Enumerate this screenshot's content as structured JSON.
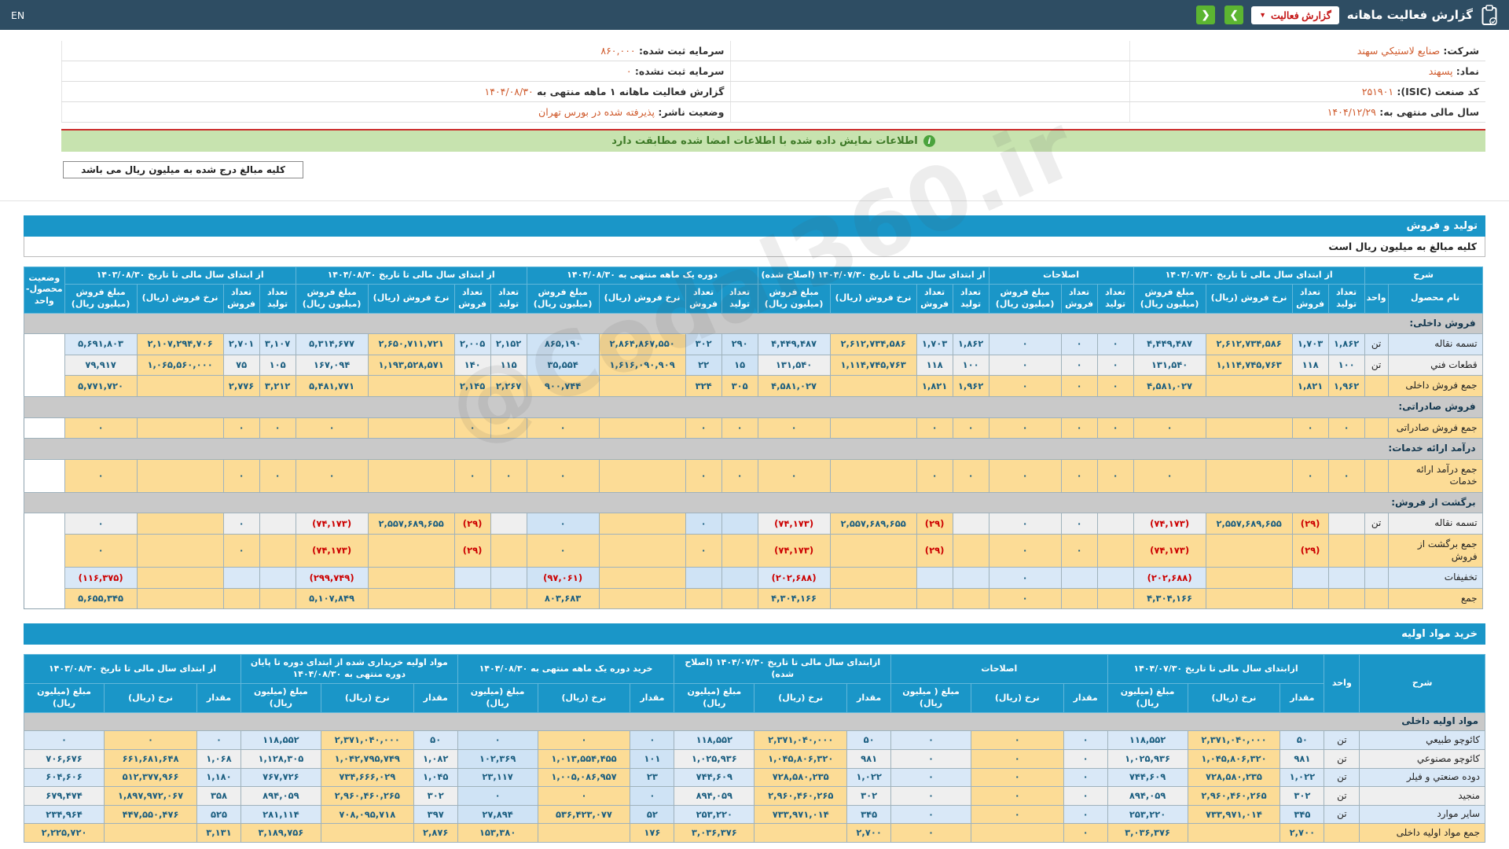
{
  "topbar": {
    "en": "EN",
    "title": "گزارش فعالیت ماهانه",
    "report_dropdown": "گزارش فعالیت"
  },
  "company_info": {
    "rows": [
      {
        "right_label": "شرکت:",
        "right_value": "صنايع لاستيکي سهند",
        "left_label": "سرمایه ثبت شده:",
        "left_value": "۸۶۰,۰۰۰"
      },
      {
        "right_label": "نماد:",
        "right_value": "پسهند",
        "left_label": "سرمایه ثبت نشده:",
        "left_value": "۰"
      },
      {
        "right_label": "کد صنعت (ISIC):",
        "right_value": "۲۵۱۹۰۱",
        "left_label": "گزارش فعالیت ماهانه ۱ ماهه منتهی به",
        "left_value": "۱۴۰۴/۰۸/۳۰"
      },
      {
        "right_label": "سال مالی منتهی به:",
        "right_value": "۱۴۰۴/۱۲/۲۹",
        "left_label": "وضعیت ناشر:",
        "left_value": "پذیرفته شده در بورس تهران"
      }
    ]
  },
  "notice": {
    "text": "اطلاعات نمایش داده شده با اطلاعات امضا شده مطابقت دارد"
  },
  "unit_note_box": "کلیه مبالغ درج شده به میلیون ریال می باشد",
  "watermark": "@Codal360.ir",
  "production_sales": {
    "section_title": "تولید و فروش",
    "unit_note": "کلیه مبالغ به میلیون ریال است",
    "groups": [
      {
        "title": "شرح",
        "subs": [
          "نام محصول",
          "واحد"
        ]
      },
      {
        "title": "از ابتدای سال مالی تا تاریخ ۱۴۰۴/۰۷/۳۰",
        "subs": [
          "تعداد تولید",
          "تعداد فروش",
          "نرخ فروش (ریال)",
          "مبلغ فروش (میلیون ریال)"
        ]
      },
      {
        "title": "اصلاحات",
        "subs": [
          "تعداد تولید",
          "تعداد فروش",
          "مبلغ فروش (میلیون ریال)"
        ]
      },
      {
        "title": "از ابتدای سال مالی تا تاریخ ۱۴۰۴/۰۷/۳۰ (اصلاح شده)",
        "subs": [
          "تعداد تولید",
          "تعداد فروش",
          "نرخ فروش (ریال)",
          "مبلغ فروش (میلیون ریال)"
        ]
      },
      {
        "title": "دوره یک ماهه منتهی به ۱۴۰۴/۰۸/۳۰",
        "hl": 1,
        "subs": [
          "تعداد تولید",
          "تعداد فروش",
          "نرخ فروش (ریال)",
          "مبلغ فروش (میلیون ریال)"
        ]
      },
      {
        "title": "از ابتدای سال مالی تا تاریخ ۱۴۰۴/۰۸/۳۰",
        "subs": [
          "تعداد تولید",
          "تعداد فروش",
          "نرخ فروش (ریال)",
          "مبلغ فروش (میلیون ریال)"
        ]
      },
      {
        "title": "از ابتدای سال مالی تا تاریخ ۱۴۰۳/۰۸/۳۰",
        "subs": [
          "تعداد تولید",
          "تعداد فروش",
          "نرخ فروش (ریال)",
          "مبلغ فروش (میلیون ریال)"
        ]
      },
      {
        "title": "وضعیت محصول-واحد",
        "subs": []
      }
    ],
    "rows": [
      {
        "sec": "فروش داخلی:"
      },
      {
        "n": "تسمه نقاله",
        "u": "تن",
        "c": "blue",
        "st": "تولید",
        "v": [
          "۱,۸۶۲",
          "۱,۷۰۳",
          "۲,۶۱۲,۷۳۴,۵۸۶",
          "۴,۴۴۹,۴۸۷",
          "۰",
          "۰",
          "۰",
          "۱,۸۶۲",
          "۱,۷۰۳",
          "۲,۶۱۲,۷۳۴,۵۸۶",
          "۴,۴۴۹,۴۸۷",
          "۲۹۰",
          "۳۰۲",
          "۲,۸۶۴,۸۶۷,۵۵۰",
          "۸۶۵,۱۹۰",
          "۲,۱۵۲",
          "۲,۰۰۵",
          "۲,۶۵۰,۷۱۱,۷۲۱",
          "۵,۳۱۴,۶۷۷",
          "۳,۱۰۷",
          "۲,۷۰۱",
          "۲,۱۰۷,۲۹۴,۷۰۶",
          "۵,۶۹۱,۸۰۳"
        ]
      },
      {
        "n": "قطعات فني",
        "u": "تن",
        "c": "gray",
        "st": "تولید",
        "v": [
          "۱۰۰",
          "۱۱۸",
          "۱,۱۱۴,۷۴۵,۷۶۳",
          "۱۳۱,۵۴۰",
          "۰",
          "۰",
          "۰",
          "۱۰۰",
          "۱۱۸",
          "۱,۱۱۴,۷۴۵,۷۶۳",
          "۱۳۱,۵۴۰",
          "۱۵",
          "۲۲",
          "۱,۶۱۶,۰۹۰,۹۰۹",
          "۳۵,۵۵۴",
          "۱۱۵",
          "۱۴۰",
          "۱,۱۹۳,۵۲۸,۵۷۱",
          "۱۶۷,۰۹۴",
          "۱۰۵",
          "۷۵",
          "۱,۰۶۵,۵۶۰,۰۰۰",
          "۷۹,۹۱۷"
        ]
      },
      {
        "n": "جمع فروش داخلی",
        "u": "",
        "c": "sum",
        "st": "",
        "v": [
          "۱,۹۶۲",
          "۱,۸۲۱",
          "",
          "۴,۵۸۱,۰۲۷",
          "۰",
          "۰",
          "۰",
          "۱,۹۶۲",
          "۱,۸۲۱",
          "",
          "۴,۵۸۱,۰۲۷",
          "۳۰۵",
          "۳۲۴",
          "",
          "۹۰۰,۷۴۴",
          "۲,۲۶۷",
          "۲,۱۴۵",
          "",
          "۵,۴۸۱,۷۷۱",
          "۳,۲۱۲",
          "۲,۷۷۶",
          "",
          "۵,۷۷۱,۷۲۰"
        ]
      },
      {
        "sec": "فروش صادراتی:"
      },
      {
        "n": "جمع فروش صادراتی",
        "u": "",
        "c": "sum",
        "st": "",
        "v": [
          "۰",
          "۰",
          "",
          "۰",
          "۰",
          "۰",
          "۰",
          "۰",
          "۰",
          "",
          "۰",
          "۰",
          "۰",
          "",
          "۰",
          "۰",
          "۰",
          "",
          "۰",
          "۰",
          "۰",
          "",
          "۰"
        ]
      },
      {
        "sec": "درآمد ارائه خدمات:"
      },
      {
        "n": "جمع درآمد ارائه خدمات",
        "u": "",
        "c": "sum",
        "st": "",
        "v": [
          "۰",
          "۰",
          "",
          "۰",
          "۰",
          "۰",
          "۰",
          "۰",
          "۰",
          "",
          "۰",
          "۰",
          "۰",
          "",
          "۰",
          "۰",
          "۰",
          "",
          "۰",
          "۰",
          "۰",
          "",
          "۰"
        ]
      },
      {
        "sec": "برگشت از فروش:"
      },
      {
        "n": "تسمه نقاله",
        "u": "تن",
        "c": "gray",
        "st": "تولید",
        "y": [
          1,
          8,
          16
        ],
        "v": [
          "",
          "(۲۹)",
          "۲,۵۵۷,۶۸۹,۶۵۵",
          "(۷۴,۱۷۳)",
          "",
          "۰",
          "۰",
          "",
          "(۲۹)",
          "۲,۵۵۷,۶۸۹,۶۵۵",
          "(۷۴,۱۷۳)",
          "",
          "۰",
          "",
          "۰",
          "",
          "(۲۹)",
          "۲,۵۵۷,۶۸۹,۶۵۵",
          "(۷۴,۱۷۳)",
          "",
          "۰",
          "",
          "۰"
        ]
      },
      {
        "n": "جمع برگشت از فروش",
        "u": "",
        "c": "sum",
        "st": "",
        "v": [
          "",
          "(۲۹)",
          "",
          "(۷۴,۱۷۳)",
          "",
          "۰",
          "۰",
          "",
          "(۲۹)",
          "",
          "(۷۴,۱۷۳)",
          "",
          "۰",
          "",
          "۰",
          "",
          "(۲۹)",
          "",
          "(۷۴,۱۷۳)",
          "",
          "۰",
          "",
          "۰"
        ]
      },
      {
        "n": "تخفیفات",
        "u": "",
        "c": "blue",
        "st": "",
        "v": [
          "",
          "",
          "",
          "(۲۰۲,۶۸۸)",
          "",
          "",
          "۰",
          "",
          "",
          "",
          "(۲۰۲,۶۸۸)",
          "",
          "",
          "",
          "(۹۷,۰۶۱)",
          "",
          "",
          "",
          "(۲۹۹,۷۴۹)",
          "",
          "",
          "",
          "(۱۱۶,۳۷۵)"
        ]
      },
      {
        "n": "جمع",
        "u": "",
        "c": "sum",
        "st": "",
        "v": [
          "",
          "",
          "",
          "۴,۳۰۴,۱۶۶",
          "",
          "",
          "۰",
          "",
          "",
          "",
          "۴,۳۰۴,۱۶۶",
          "",
          "",
          "",
          "۸۰۳,۶۸۳",
          "",
          "",
          "",
          "۵,۱۰۷,۸۴۹",
          "",
          "",
          "",
          "۵,۶۵۵,۳۴۵"
        ]
      }
    ]
  },
  "raw_materials": {
    "section_title": "خرید مواد اولیه",
    "groups": [
      {
        "title": "شرح",
        "subs": []
      },
      {
        "title": "واحد",
        "subs": []
      },
      {
        "title": "ازابتدای سال مالی تا تاریخ ۱۴۰۴/۰۷/۳۰",
        "subs": [
          "مقدار",
          "نرخ (ریال)",
          "مبلغ (میلیون ریال)"
        ]
      },
      {
        "title": "اصلاحات",
        "subs": [
          "مقدار",
          "نرخ (ریال)",
          "مبلغ ( میلیون ریال)"
        ]
      },
      {
        "title": "ازابتدای سال مالی تا تاریخ ۱۴۰۴/۰۷/۳۰ (اصلاح شده)",
        "subs": [
          "مقدار",
          "نرخ (ریال)",
          "مبلغ (میلیون ریال)"
        ]
      },
      {
        "title": "خرید دوره یک ماهه منتهی به ۱۴۰۴/۰۸/۳۰",
        "hl": 1,
        "subs": [
          "مقدار",
          "نرخ (ریال)",
          "مبلغ (میلیون ریال)"
        ]
      },
      {
        "title": "مواد اولیه خریداری شده از ابتدای دوره تا پایان دوره منتهی به ۱۴۰۴/۰۸/۳۰",
        "subs": [
          "مقدار",
          "نرخ (ریال)",
          "مبلغ (میلیون ریال)"
        ]
      },
      {
        "title": "از ابتدای سال مالی تا تاریخ ۱۴۰۳/۰۸/۳۰",
        "subs": [
          "مقدار",
          "نرخ (ریال)",
          "مبلغ (میلیون ریال)"
        ]
      }
    ],
    "rows": [
      {
        "sec": "مواد اولیه داخلی"
      },
      {
        "n": "کائوچو طبيعي",
        "u": "تن",
        "c": "blue",
        "v": [
          "۵۰",
          "۲,۳۷۱,۰۴۰,۰۰۰",
          "۱۱۸,۵۵۲",
          "۰",
          "۰",
          "۰",
          "۵۰",
          "۲,۳۷۱,۰۴۰,۰۰۰",
          "۱۱۸,۵۵۲",
          "۰",
          "۰",
          "۰",
          "۵۰",
          "۲,۳۷۱,۰۴۰,۰۰۰",
          "۱۱۸,۵۵۲",
          "۰",
          "۰",
          "۰"
        ]
      },
      {
        "n": "کائوچو مصنوعي",
        "u": "تن",
        "c": "gray",
        "v": [
          "۹۸۱",
          "۱,۰۴۵,۸۰۶,۳۲۰",
          "۱,۰۲۵,۹۳۶",
          "۰",
          "۰",
          "۰",
          "۹۸۱",
          "۱,۰۴۵,۸۰۶,۳۲۰",
          "۱,۰۲۵,۹۳۶",
          "۱۰۱",
          "۱,۰۱۳,۵۵۴,۴۵۵",
          "۱۰۲,۳۶۹",
          "۱,۰۸۲",
          "۱,۰۴۲,۷۹۵,۷۴۹",
          "۱,۱۲۸,۳۰۵",
          "۱,۰۶۸",
          "۶۶۱,۶۸۱,۶۴۸",
          "۷۰۶,۶۷۶"
        ]
      },
      {
        "n": "دوده صنعتي و فیلر",
        "u": "تن",
        "c": "blue",
        "v": [
          "۱,۰۲۲",
          "۷۲۸,۵۸۰,۲۳۵",
          "۷۴۴,۶۰۹",
          "۰",
          "۰",
          "۰",
          "۱,۰۲۲",
          "۷۲۸,۵۸۰,۲۳۵",
          "۷۴۴,۶۰۹",
          "۲۳",
          "۱,۰۰۵,۰۸۶,۹۵۷",
          "۲۳,۱۱۷",
          "۱,۰۴۵",
          "۷۳۴,۶۶۶,۰۲۹",
          "۷۶۷,۷۲۶",
          "۱,۱۸۰",
          "۵۱۲,۳۷۷,۹۶۶",
          "۶۰۴,۶۰۶"
        ]
      },
      {
        "n": "منجید",
        "u": "تن",
        "c": "gray",
        "v": [
          "۳۰۲",
          "۲,۹۶۰,۴۶۰,۲۶۵",
          "۸۹۴,۰۵۹",
          "۰",
          "۰",
          "۰",
          "۳۰۲",
          "۲,۹۶۰,۴۶۰,۲۶۵",
          "۸۹۴,۰۵۹",
          "۰",
          "۰",
          "۰",
          "۳۰۲",
          "۲,۹۶۰,۴۶۰,۲۶۵",
          "۸۹۴,۰۵۹",
          "۳۵۸",
          "۱,۸۹۷,۹۷۲,۰۶۷",
          "۶۷۹,۴۷۴"
        ]
      },
      {
        "n": "سایر موارد",
        "u": "تن",
        "c": "blue",
        "v": [
          "۳۴۵",
          "۷۳۳,۹۷۱,۰۱۴",
          "۲۵۳,۲۲۰",
          "۰",
          "۰",
          "۰",
          "۳۴۵",
          "۷۳۳,۹۷۱,۰۱۴",
          "۲۵۳,۲۲۰",
          "۵۲",
          "۵۳۶,۴۲۳,۰۷۷",
          "۲۷,۸۹۴",
          "۳۹۷",
          "۷۰۸,۰۹۵,۷۱۸",
          "۲۸۱,۱۱۴",
          "۵۲۵",
          "۴۴۷,۵۵۰,۴۷۶",
          "۲۳۴,۹۶۴"
        ]
      },
      {
        "n": "جمع مواد اولیه داخلی",
        "u": "",
        "c": "sum",
        "v": [
          "۲,۷۰۰",
          "",
          "۳,۰۳۶,۳۷۶",
          "۰",
          "",
          "۰",
          "۲,۷۰۰",
          "",
          "۳,۰۳۶,۳۷۶",
          "۱۷۶",
          "",
          "۱۵۳,۳۸۰",
          "۲,۸۷۶",
          "",
          "۳,۱۸۹,۷۵۶",
          "۳,۱۳۱",
          "",
          "۲,۲۲۵,۷۲۰"
        ]
      }
    ]
  }
}
